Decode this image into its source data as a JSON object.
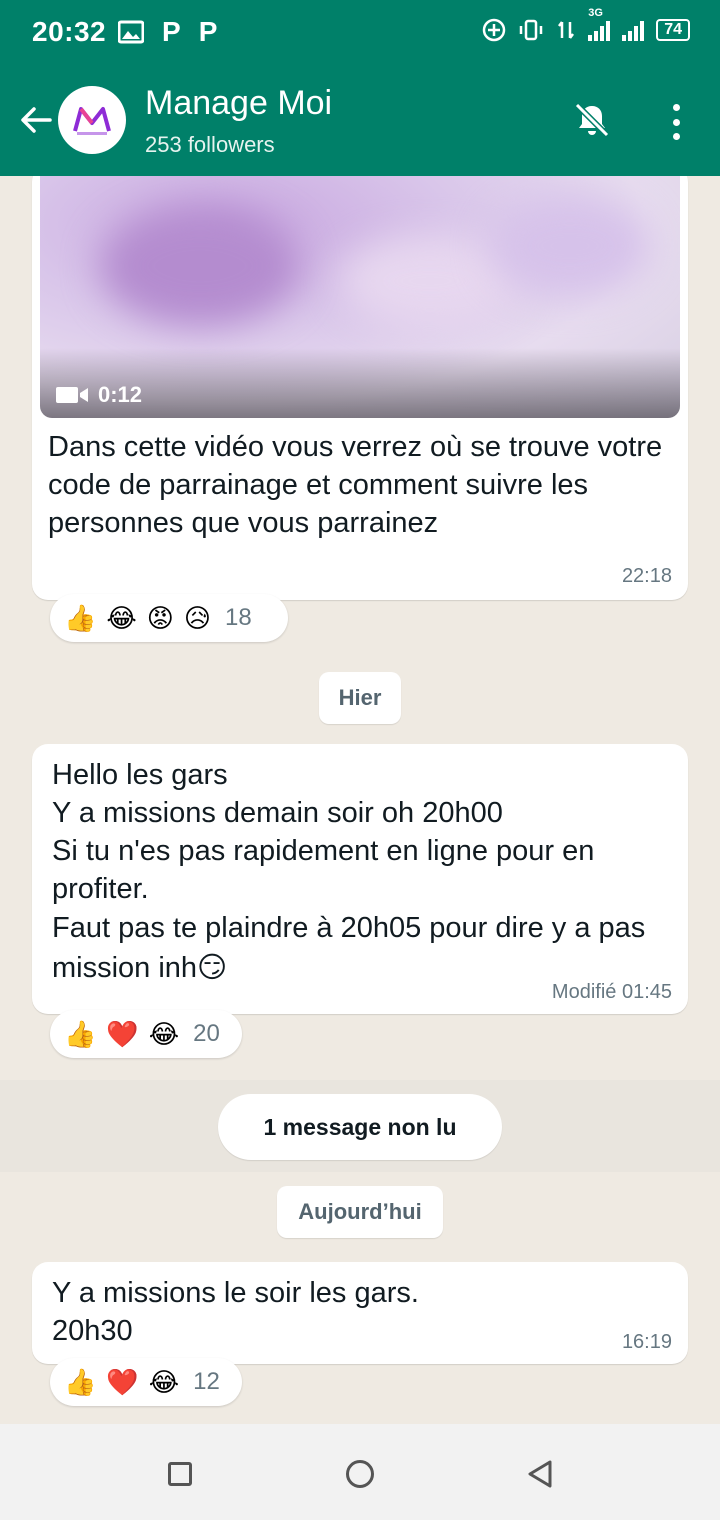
{
  "status_bar": {
    "time": "20:32",
    "left_icons": [
      "gallery-icon",
      "p-icon",
      "p-icon"
    ],
    "left_labels": [
      "P",
      "P"
    ],
    "network": "3G",
    "battery": "74"
  },
  "header": {
    "title": "Manage Moi",
    "subtitle": "253 followers",
    "icons": [
      "back-arrow-icon",
      "mute-bell-icon",
      "more-vert-icon"
    ]
  },
  "messages": [
    {
      "video_duration": "0:12",
      "text": "Dans cette vidéo vous verrez où se trouve votre code de parrainage et comment suivre les personnes que vous parrainez",
      "time": "22:18",
      "reactions": [
        "👍",
        "😂",
        "😡",
        "😥"
      ],
      "reaction_count": "18"
    },
    {
      "text_lines": [
        "Hello les gars",
        "Y a missions demain soir oh 20h00",
        "Si tu n'es pas rapidement en ligne pour en profiter.",
        "Faut pas te plaindre à 20h05 pour dire y a pas mission inh😏"
      ],
      "time": "Modifié 01:45",
      "reactions": [
        "👍",
        "❤️",
        "😂"
      ],
      "reaction_count": "20"
    },
    {
      "text_lines": [
        "Y a missions le soir les gars.",
        "20h30"
      ],
      "time": "16:19",
      "reactions": [
        "👍",
        "❤️",
        "😂"
      ],
      "reaction_count": "12"
    }
  ],
  "dividers": {
    "yesterday": "Hier",
    "unread": "1 message non lu",
    "today": "Aujourd’hui"
  },
  "colors": {
    "header": "#008069",
    "chat_bg": "#efeae2",
    "bubble": "#ffffff",
    "time_text": "#667781"
  }
}
